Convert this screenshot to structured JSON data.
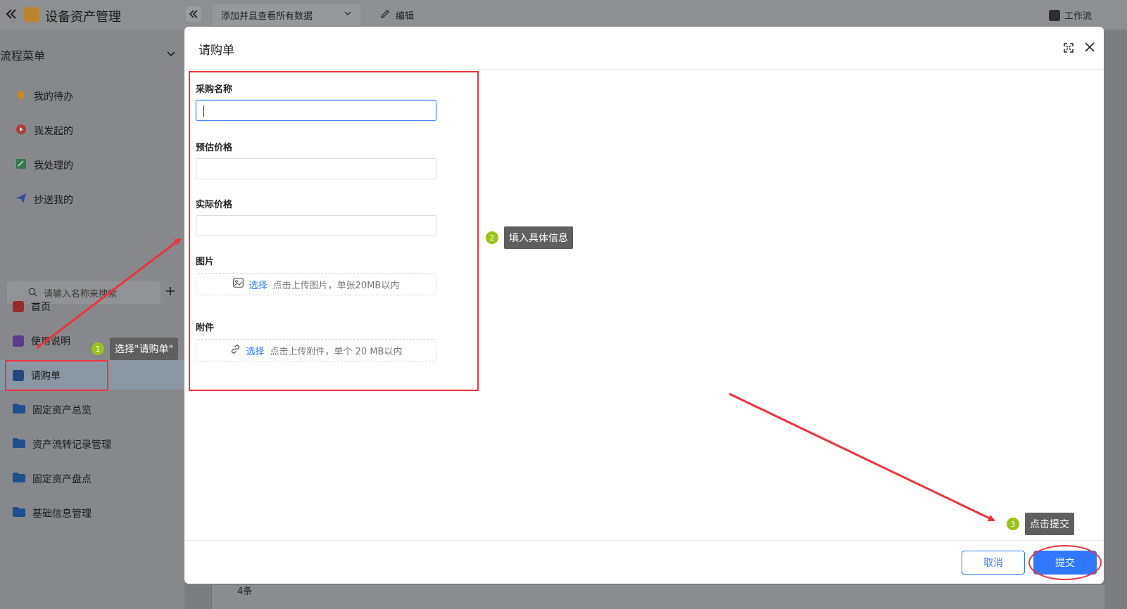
{
  "app": {
    "title": "设备资产管理",
    "workflow_label": "工作流"
  },
  "toolbar": {
    "view_select": "添加并且查看所有数据",
    "edit_label": "编辑"
  },
  "sidebar": {
    "section_title": "流程菜单",
    "flow_items": [
      {
        "label": "我的待办",
        "icon": "bell-icon"
      },
      {
        "label": "我发起的",
        "icon": "play-icon"
      },
      {
        "label": "我处理的",
        "icon": "edit-icon"
      },
      {
        "label": "抄送我的",
        "icon": "send-icon"
      }
    ],
    "search_placeholder": "请输入名称来搜索",
    "nav_items": [
      {
        "label": "首页",
        "icon": "home-icon"
      },
      {
        "label": "使用说明",
        "icon": "guide-icon"
      },
      {
        "label": "请购单",
        "icon": "form-icon"
      },
      {
        "label": "固定资产总览",
        "icon": "folder-icon"
      },
      {
        "label": "资产流转记录管理",
        "icon": "folder-icon"
      },
      {
        "label": "固定资产盘点",
        "icon": "folder-icon"
      },
      {
        "label": "基础信息管理",
        "icon": "folder-icon"
      }
    ]
  },
  "modal": {
    "title": "请购单",
    "fields": {
      "purchase_name": {
        "label": "采购名称",
        "value": ""
      },
      "estimated_price": {
        "label": "预估价格",
        "value": ""
      },
      "actual_price": {
        "label": "实际价格",
        "value": ""
      },
      "image": {
        "label": "图片",
        "select": "选择",
        "hint": "点击上传图片，单张20MB以内"
      },
      "attachment": {
        "label": "附件",
        "select": "选择",
        "hint": "点击上传附件，单个 20 MB以内"
      }
    },
    "cancel_label": "取消",
    "submit_label": "提交"
  },
  "annotations": [
    {
      "number": "1",
      "text": "选择\"请购单\""
    },
    {
      "number": "2",
      "text": "填入具体信息"
    },
    {
      "number": "3",
      "text": "点击提交"
    }
  ],
  "background": {
    "row_fragment": "4条"
  },
  "colors": {
    "accent": "#2f78ff",
    "annotation_red": "#f0333b",
    "step_badge": "#9bc21a"
  }
}
